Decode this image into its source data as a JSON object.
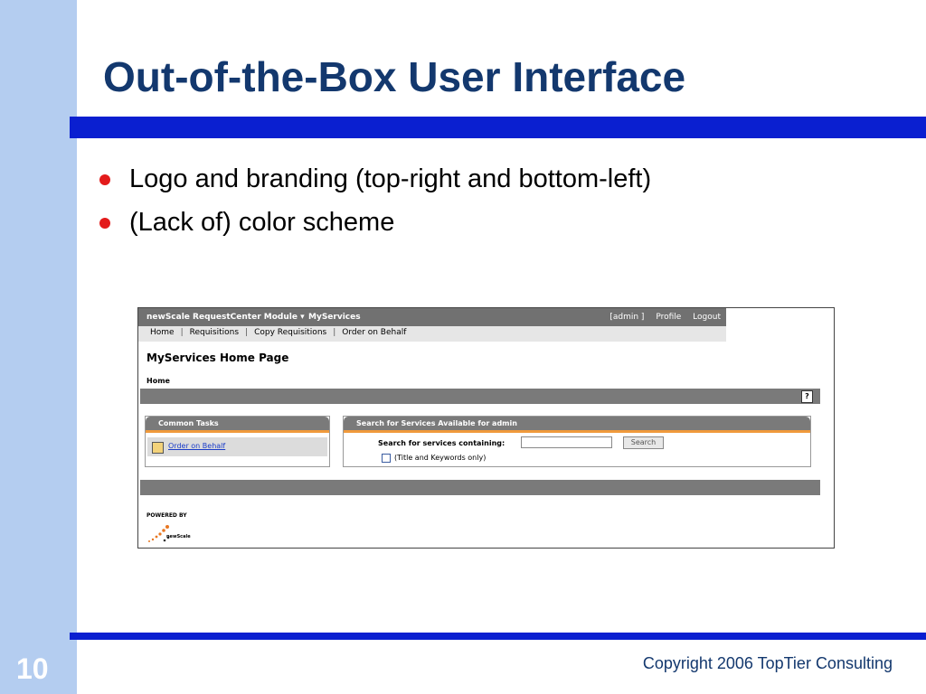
{
  "slide": {
    "title": "Out-of-the-Box User Interface",
    "bullets": [
      "Logo and branding (top-right and bottom-left)",
      "(Lack of) color scheme"
    ],
    "slide_number": "10",
    "copyright": "Copyright 2006 TopTier Consulting",
    "colors": {
      "band": "#b4cdf0",
      "rule": "#0a1fd0",
      "title": "#13386e",
      "bullet": "#e31b1b"
    }
  },
  "screenshot": {
    "topbar": {
      "brand": "newScale RequestCenter Module ▾",
      "module": "MyServices",
      "util_links": [
        "[admin ]",
        "Profile",
        "Logout"
      ]
    },
    "nav": [
      "Home",
      "Requisitions",
      "Copy Requisitions",
      "Order on Behalf"
    ],
    "nav_sep": "|",
    "page_title": "MyServices Home Page",
    "breadcrumb": "Home",
    "help": "?",
    "common_tasks": {
      "header": "Common Tasks",
      "items": [
        "Order on Behalf"
      ]
    },
    "search": {
      "header": "Search for Services Available for admin",
      "label": "Search for services containing:",
      "value": "",
      "button": "Search",
      "checkbox_label": "(Title and Keywords only)",
      "checkbox_checked": false
    },
    "footer": {
      "powered_by": "POWERED BY",
      "logo_text": "newScale"
    },
    "colors": {
      "bar": "#7a7a7a",
      "accent": "#f09a3c",
      "link": "#1a3cc8"
    }
  }
}
